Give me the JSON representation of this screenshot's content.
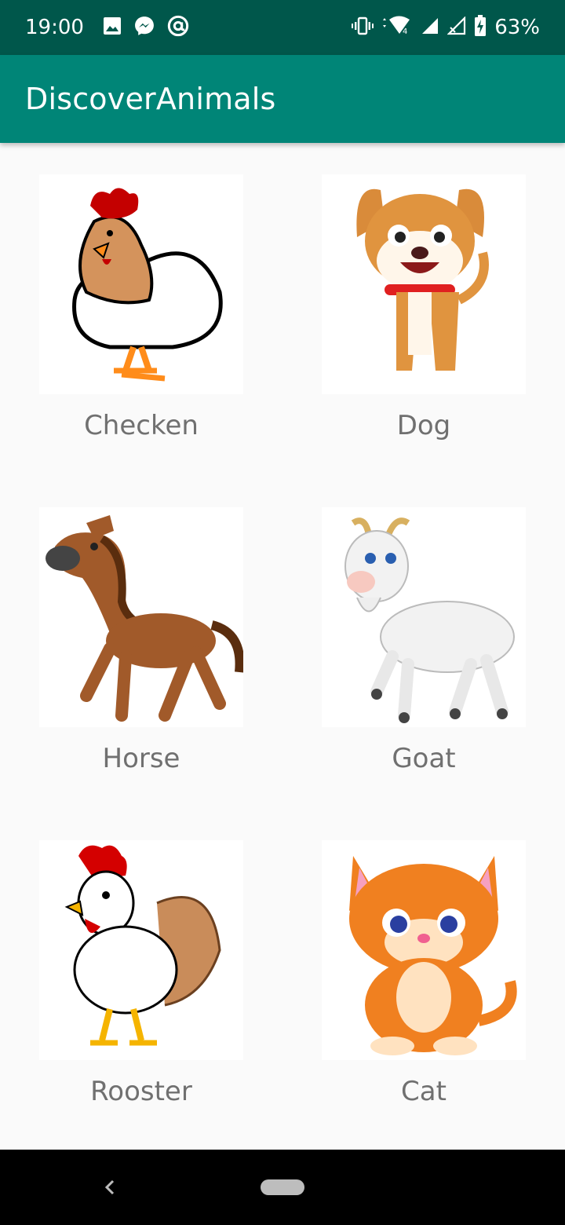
{
  "status_bar": {
    "time": "19:00",
    "battery": "63%",
    "left_icons": [
      "image-icon",
      "messenger-icon",
      "at-sign-icon"
    ],
    "right_icons": [
      "vibrate-icon",
      "wifi-icon",
      "signal-icon",
      "signal-no-data-icon",
      "battery-charging-icon"
    ]
  },
  "app_bar": {
    "title": "DiscoverAnimals"
  },
  "animals": [
    {
      "label": "Checken",
      "icon": "chicken-icon"
    },
    {
      "label": "Dog",
      "icon": "dog-icon"
    },
    {
      "label": "Horse",
      "icon": "horse-icon"
    },
    {
      "label": "Goat",
      "icon": "goat-icon"
    },
    {
      "label": "Rooster",
      "icon": "rooster-icon"
    },
    {
      "label": "Cat",
      "icon": "cat-icon"
    }
  ],
  "nav_bar": {
    "icons": [
      "back-icon",
      "home-pill-icon"
    ]
  },
  "colors": {
    "status_bar": "#00574b",
    "app_bar": "#008577",
    "background": "#fafafa",
    "label_text": "#707070"
  }
}
